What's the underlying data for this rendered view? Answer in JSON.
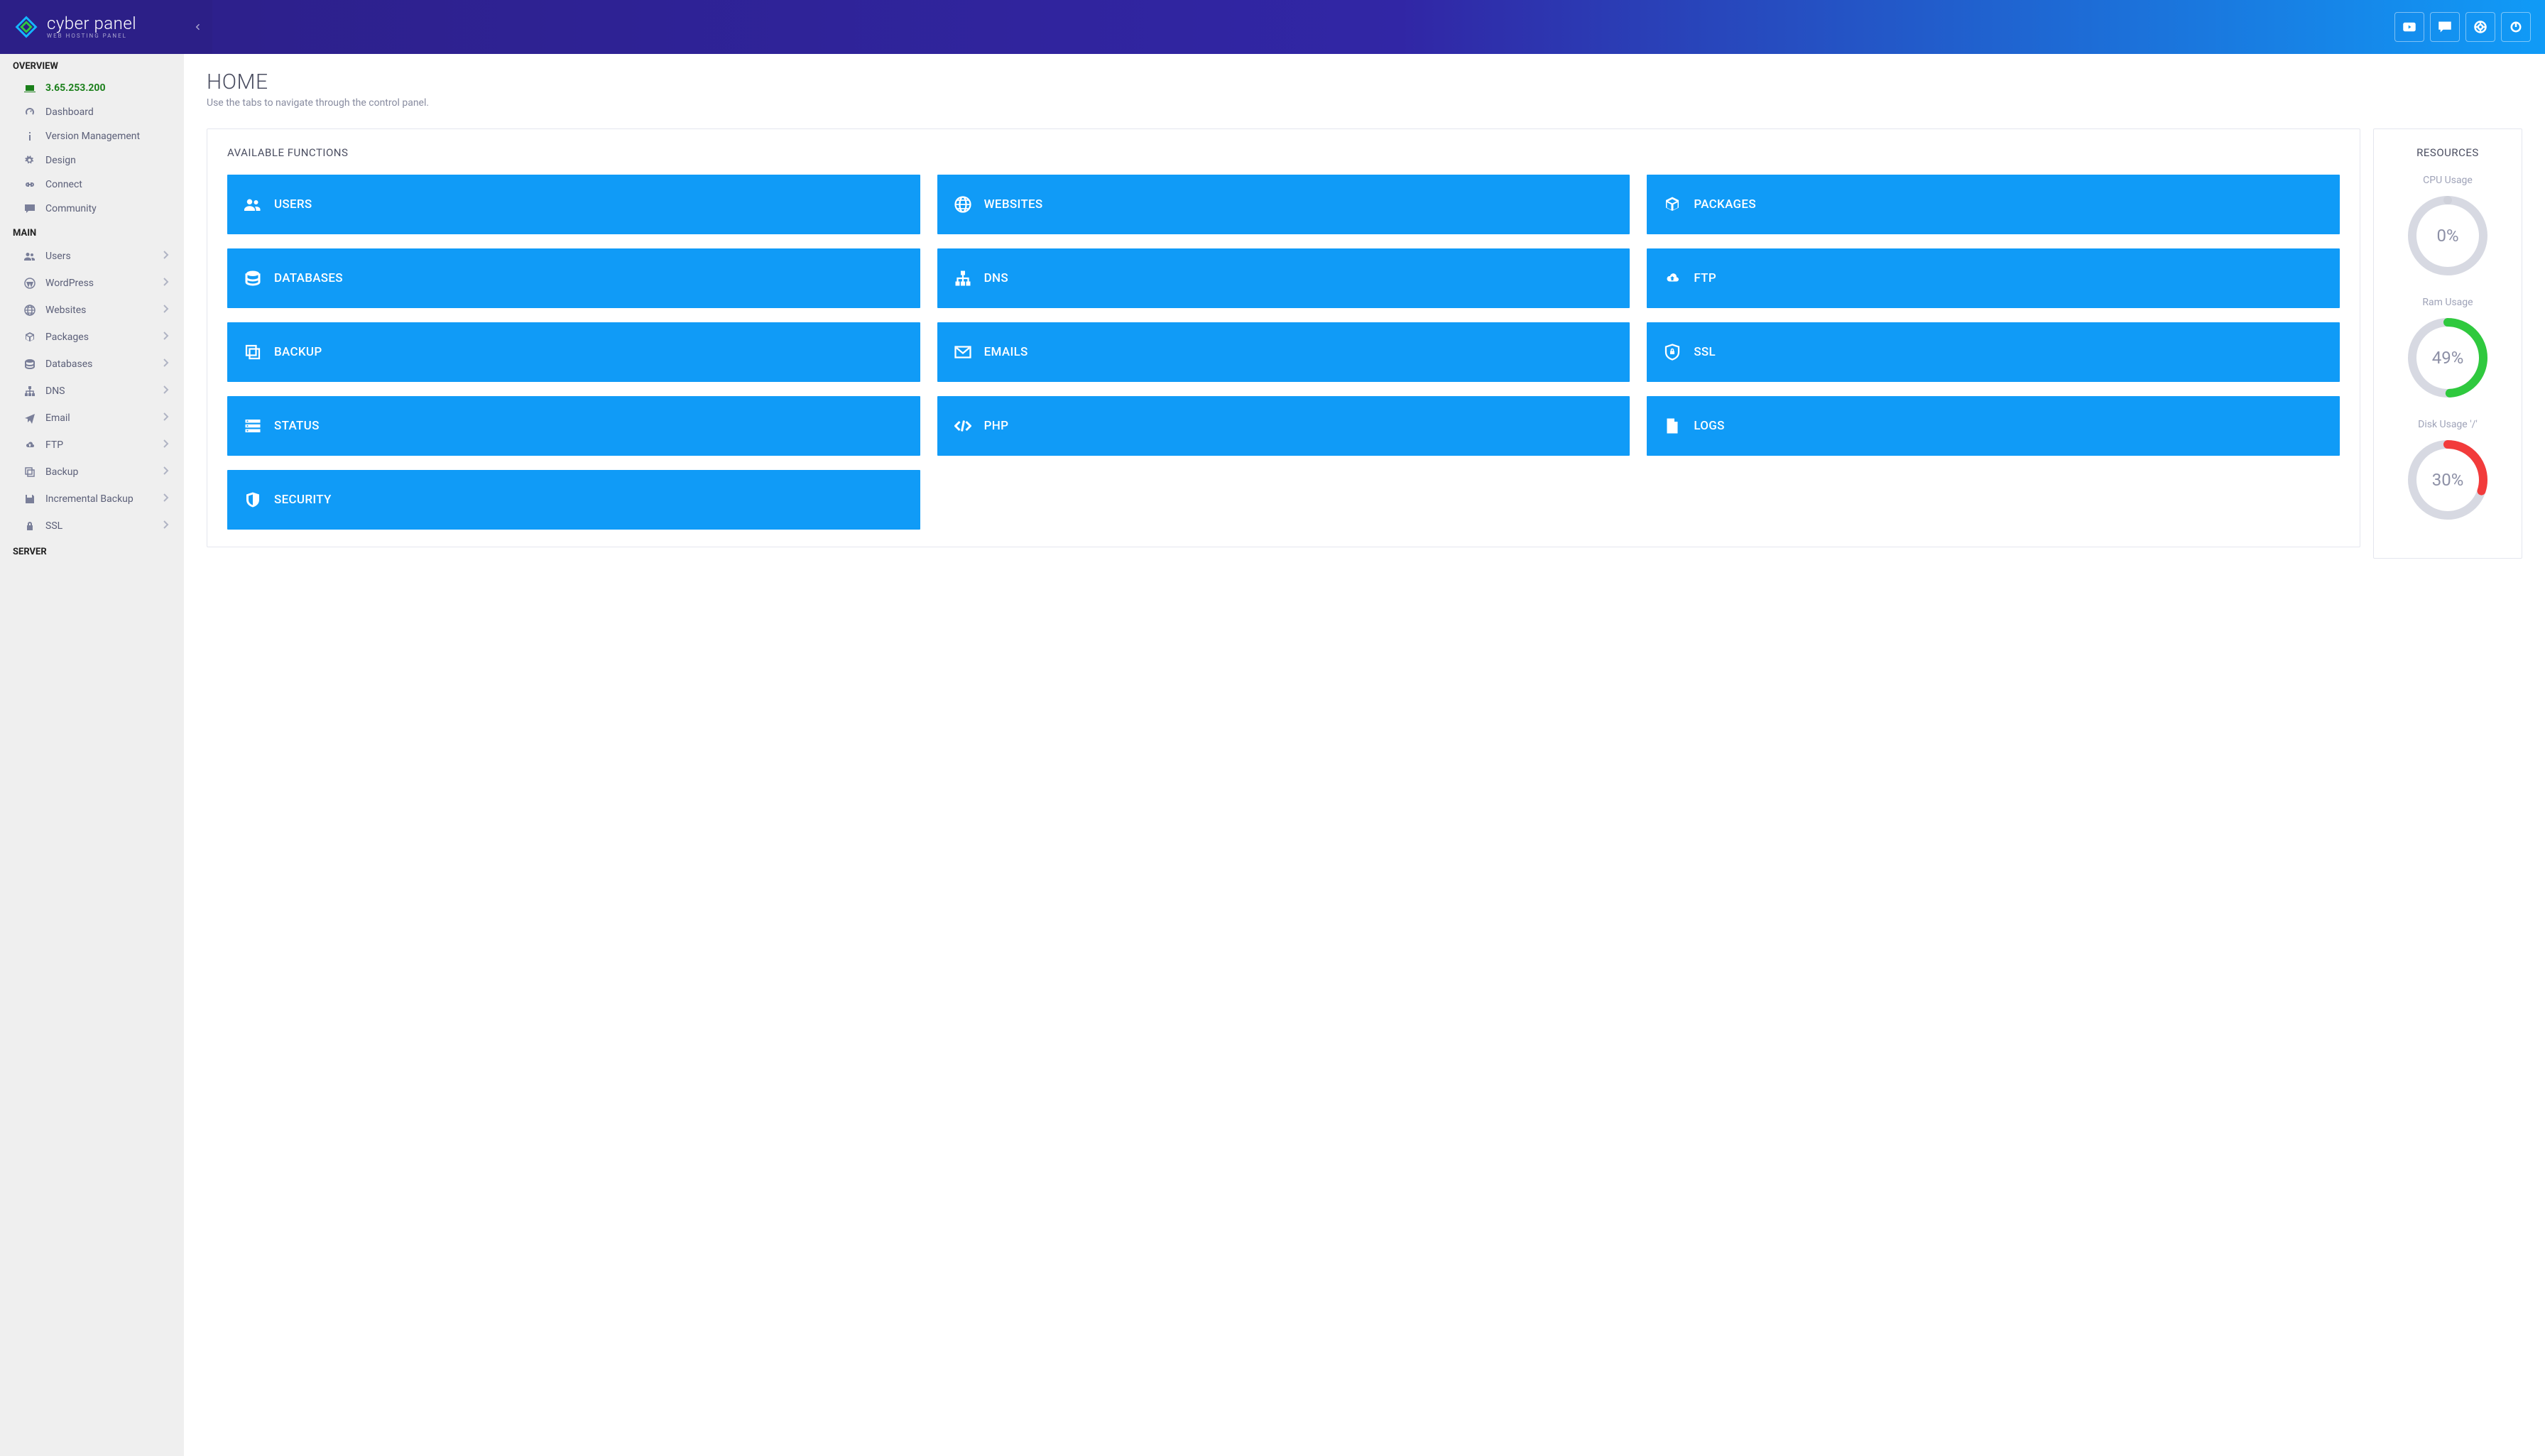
{
  "brand": {
    "name": "cyber panel",
    "sub": "WEB HOSTING PANEL"
  },
  "page": {
    "title": "HOME",
    "subtitle": "Use the tabs to navigate through the control panel."
  },
  "panels": {
    "functions_heading": "AVAILABLE FUNCTIONS",
    "resources_heading": "RESOURCES"
  },
  "sidebar": {
    "sections": [
      {
        "label": "OVERVIEW",
        "items": [
          {
            "icon": "laptop",
            "label": "3.65.253.200",
            "active": true
          },
          {
            "icon": "dashboard",
            "label": "Dashboard"
          },
          {
            "icon": "info",
            "label": "Version Management"
          },
          {
            "icon": "gear",
            "label": "Design"
          },
          {
            "icon": "link",
            "label": "Connect"
          },
          {
            "icon": "chat",
            "label": "Community"
          }
        ]
      },
      {
        "label": "MAIN",
        "items": [
          {
            "icon": "users",
            "label": "Users",
            "expand": true
          },
          {
            "icon": "wordpress",
            "label": "WordPress",
            "expand": true
          },
          {
            "icon": "globe",
            "label": "Websites",
            "expand": true
          },
          {
            "icon": "packages",
            "label": "Packages",
            "expand": true
          },
          {
            "icon": "database",
            "label": "Databases",
            "expand": true
          },
          {
            "icon": "sitemap",
            "label": "DNS",
            "expand": true
          },
          {
            "icon": "plane",
            "label": "Email",
            "expand": true
          },
          {
            "icon": "cloud-up",
            "label": "FTP",
            "expand": true
          },
          {
            "icon": "copy",
            "label": "Backup",
            "expand": true
          },
          {
            "icon": "save",
            "label": "Incremental Backup",
            "expand": true
          },
          {
            "icon": "lock",
            "label": "SSL",
            "expand": true
          }
        ]
      },
      {
        "label": "SERVER",
        "items": []
      }
    ]
  },
  "tiles": [
    {
      "icon": "users",
      "label": "USERS"
    },
    {
      "icon": "globe",
      "label": "WEBSITES"
    },
    {
      "icon": "packages",
      "label": "PACKAGES"
    },
    {
      "icon": "database",
      "label": "DATABASES"
    },
    {
      "icon": "sitemap",
      "label": "DNS"
    },
    {
      "icon": "cloud-up",
      "label": "FTP"
    },
    {
      "icon": "copy",
      "label": "BACKUP"
    },
    {
      "icon": "envelope",
      "label": "EMAILS"
    },
    {
      "icon": "shield-lock",
      "label": "SSL"
    },
    {
      "icon": "server",
      "label": "STATUS"
    },
    {
      "icon": "code",
      "label": "PHP"
    },
    {
      "icon": "file",
      "label": "LOGS"
    },
    {
      "icon": "shield",
      "label": "SECURITY"
    }
  ],
  "resources": [
    {
      "label": "CPU Usage",
      "percent": 0,
      "color": "#cfd1da"
    },
    {
      "label": "Ram Usage",
      "percent": 49,
      "color": "#2fc93e"
    },
    {
      "label": "Disk Usage '/'",
      "percent": 30,
      "color": "#f23b3b"
    }
  ]
}
